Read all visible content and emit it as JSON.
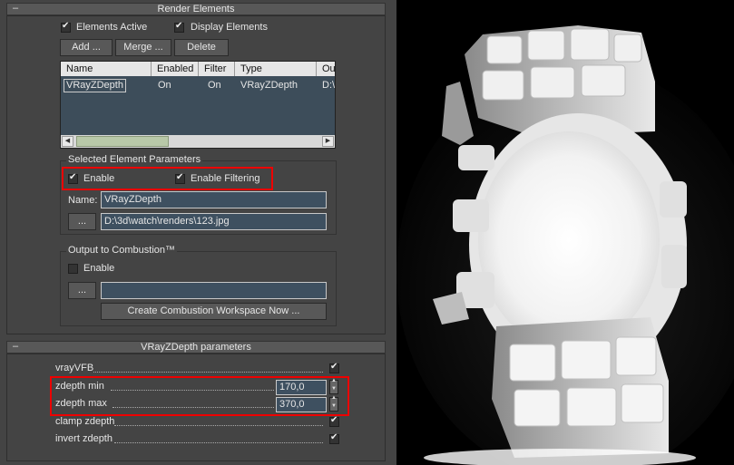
{
  "render_elements": {
    "rollout_title": "Render Elements",
    "minus": "–",
    "elements_active": "Elements Active",
    "display_elements": "Display Elements",
    "add": "Add ...",
    "merge": "Merge ...",
    "delete": "Delete",
    "columns": [
      "Name",
      "Enabled",
      "Filter",
      "Type",
      "Ou"
    ],
    "row": {
      "name": "VRayZDepth",
      "enabled": "On",
      "filter": "On",
      "type": "VRayZDepth",
      "out": "D:\\"
    }
  },
  "selected": {
    "group_title": "Selected Element Parameters",
    "enable": "Enable",
    "enable_filtering": "Enable Filtering",
    "name_label": "Name:",
    "name_value": "VRayZDepth",
    "browse": "...",
    "path_value": "D:\\3d\\watch\\renders\\123.jpg"
  },
  "combustion": {
    "group_title": "Output to Combustion™",
    "enable": "Enable",
    "browse": "...",
    "path_value": "",
    "create": "Create Combustion Workspace Now ..."
  },
  "vray": {
    "rollout_title": "VRayZDepth parameters",
    "minus": "–",
    "vrayvfb": "vrayVFB",
    "zmin_label": "zdepth min",
    "zmin_value": "170,0",
    "zmax_label": "zdepth max",
    "zmax_value": "370,0",
    "clamp": "clamp zdepth",
    "invert": "invert zdepth"
  },
  "colors": {
    "panel": "#444444",
    "field": "#3e5060",
    "highlight": "#e00000"
  }
}
